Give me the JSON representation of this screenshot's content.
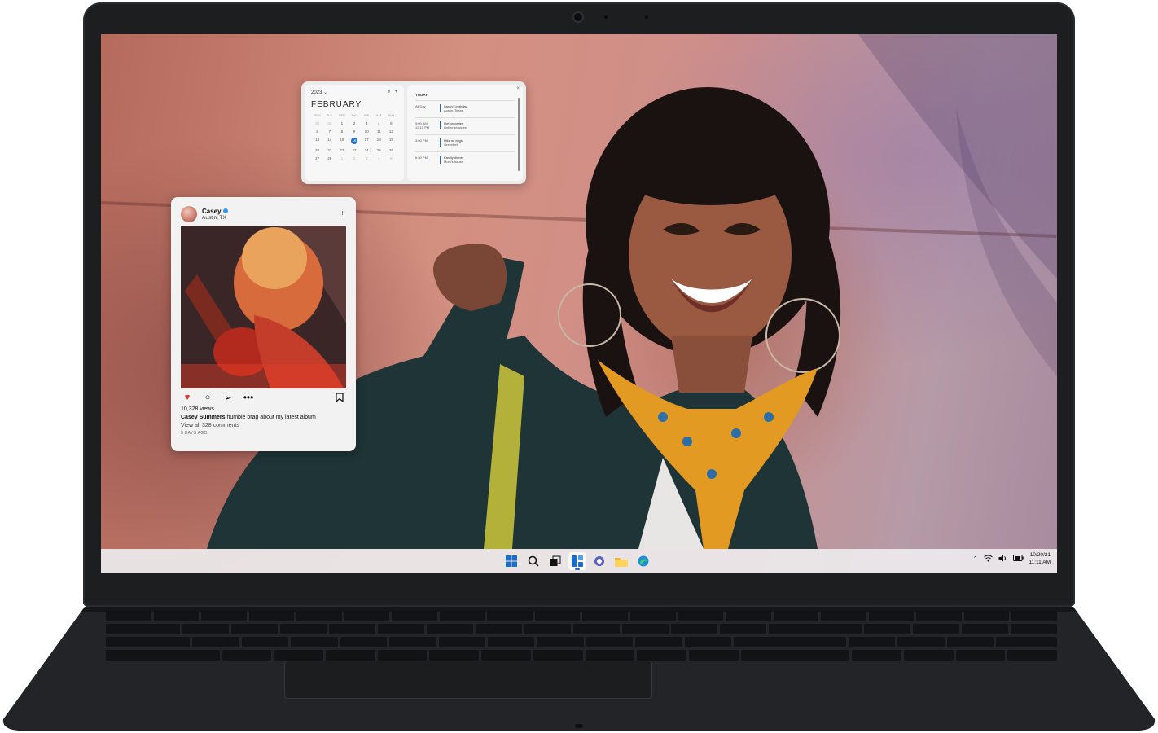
{
  "calendar": {
    "year": "2023",
    "month": "FEBRUARY",
    "weekdays": [
      "MON",
      "TUE",
      "WED",
      "THU",
      "FRI",
      "SAT",
      "SUN"
    ],
    "weeks": [
      [
        "30",
        "31",
        "1",
        "2",
        "3",
        "4",
        "5"
      ],
      [
        "6",
        "7",
        "8",
        "9",
        "10",
        "11",
        "12"
      ],
      [
        "13",
        "14",
        "15",
        "16",
        "17",
        "18",
        "19"
      ],
      [
        "20",
        "21",
        "22",
        "23",
        "24",
        "25",
        "26"
      ],
      [
        "27",
        "28",
        "1",
        "2",
        "3",
        "4",
        "5"
      ]
    ],
    "selected_day": "16",
    "agenda_title": "TODAY",
    "events": [
      {
        "time": "All Day",
        "title": "Sarah's birthday",
        "detail": "Austin, Texas"
      },
      {
        "time": "9:00 AM\n12:15 PM",
        "title": "Get groceries",
        "detail": "Online shopping"
      },
      {
        "time": "3:00 PM",
        "title": "Hike w/ dogs",
        "detail": "Greenbelt"
      },
      {
        "time": "6:30 PM",
        "title": "Family dinner",
        "detail": "Mom's house"
      }
    ]
  },
  "post": {
    "username": "Casey",
    "location": "Austin, TX",
    "views": "10,328 views",
    "caption_user": "Casey Summers",
    "caption_text": "humble brag about my latest album",
    "comments": "View all 328 comments",
    "age": "5 DAYS AGO"
  },
  "taskbar": {
    "apps": [
      "start",
      "search",
      "task-view",
      "widgets",
      "chat",
      "file-explorer",
      "edge"
    ],
    "active_app": "widgets",
    "date": "10/20/21",
    "time": "11:11 AM"
  },
  "colors": {
    "accent": "#1b6fc9",
    "laptop": "#1d1e20",
    "heart": "#e0241a"
  }
}
